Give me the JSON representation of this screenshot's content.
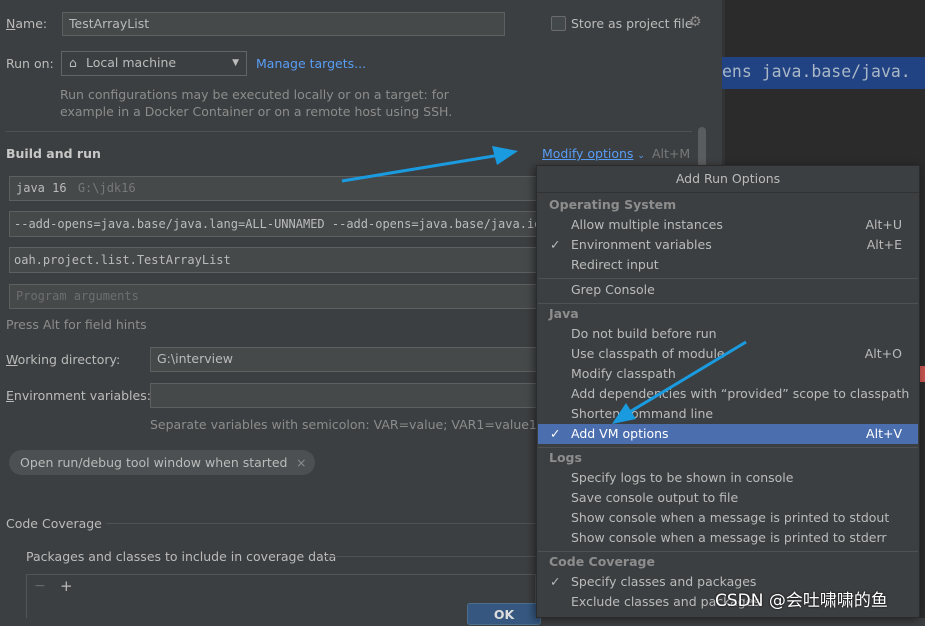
{
  "form": {
    "name_label": "Name:",
    "name_value": "TestArrayList",
    "store_label": "Store as project file",
    "run_on_label": "Run on:",
    "run_on_value": "Local machine",
    "manage_targets": "Manage targets...",
    "run_on_hint_1": "Run configurations may be executed locally or on a target: for",
    "run_on_hint_2": "example in a Docker Container or on a remote host using SSH.",
    "build_run_title": "Build and run",
    "modify_options": "Modify options",
    "modify_shortcut": "Alt+M",
    "jdk_value": "java 16",
    "jdk_path": "G:\\jdk16",
    "vm_options": "--add-opens=java.base/java.lang=ALL-UNNAMED --add-opens=java.base/java.io=A",
    "main_class": "oah.project.list.TestArrayList",
    "program_args_placeholder": "Program arguments",
    "alt_hint": "Press Alt for field hints",
    "working_dir_label": "Working directory:",
    "working_dir_value": "G:\\interview",
    "env_vars_label": "Environment variables:",
    "env_vars_hint": "Separate variables with semicolon: VAR=value; VAR1=value1",
    "open_tool_window_chip": "Open run/debug tool window when started",
    "code_coverage": "Code Coverage",
    "packages_label": "Packages and classes to include in coverage data",
    "ok_button": "OK"
  },
  "editor": {
    "code_fragment": "ens java.base/java."
  },
  "popup": {
    "title": "Add Run Options",
    "groups": [
      {
        "name": "Operating System"
      },
      {
        "name": "Java"
      },
      {
        "name": "Logs"
      },
      {
        "name": "Code Coverage"
      }
    ],
    "items": [
      {
        "label": "Allow multiple instances",
        "shortcut": "Alt+U",
        "checked": false
      },
      {
        "label": "Environment variables",
        "shortcut": "Alt+E",
        "checked": true
      },
      {
        "label": "Redirect input",
        "shortcut": "",
        "checked": false
      },
      {
        "label": "Grep Console",
        "shortcut": "",
        "checked": false
      },
      {
        "label": "Do not build before run",
        "shortcut": "",
        "checked": false
      },
      {
        "label": "Use classpath of module",
        "shortcut": "Alt+O",
        "checked": false
      },
      {
        "label": "Modify classpath",
        "shortcut": "",
        "checked": false
      },
      {
        "label": "Add dependencies with “provided” scope to classpath",
        "shortcut": "",
        "checked": false
      },
      {
        "label": "Shorten command line",
        "shortcut": "",
        "checked": false
      },
      {
        "label": "Add VM options",
        "shortcut": "Alt+V",
        "checked": true,
        "selected": true
      },
      {
        "label": "Specify logs to be shown in console",
        "shortcut": "",
        "checked": false
      },
      {
        "label": "Save console output to file",
        "shortcut": "",
        "checked": false
      },
      {
        "label": "Show console when a message is printed to stdout",
        "shortcut": "",
        "checked": false
      },
      {
        "label": "Show console when a message is printed to stderr",
        "shortcut": "",
        "checked": false
      },
      {
        "label": "Specify classes and packages",
        "shortcut": "",
        "checked": true
      },
      {
        "label": "Exclude classes and packages",
        "shortcut": "",
        "checked": false
      }
    ],
    "check_glyph": "✓"
  },
  "watermark": "CSDN @会吐啸啸的鱼",
  "colors": {
    "accent_link": "#589df6",
    "selection": "#4b6eaf",
    "arrow": "#1a9be0"
  }
}
